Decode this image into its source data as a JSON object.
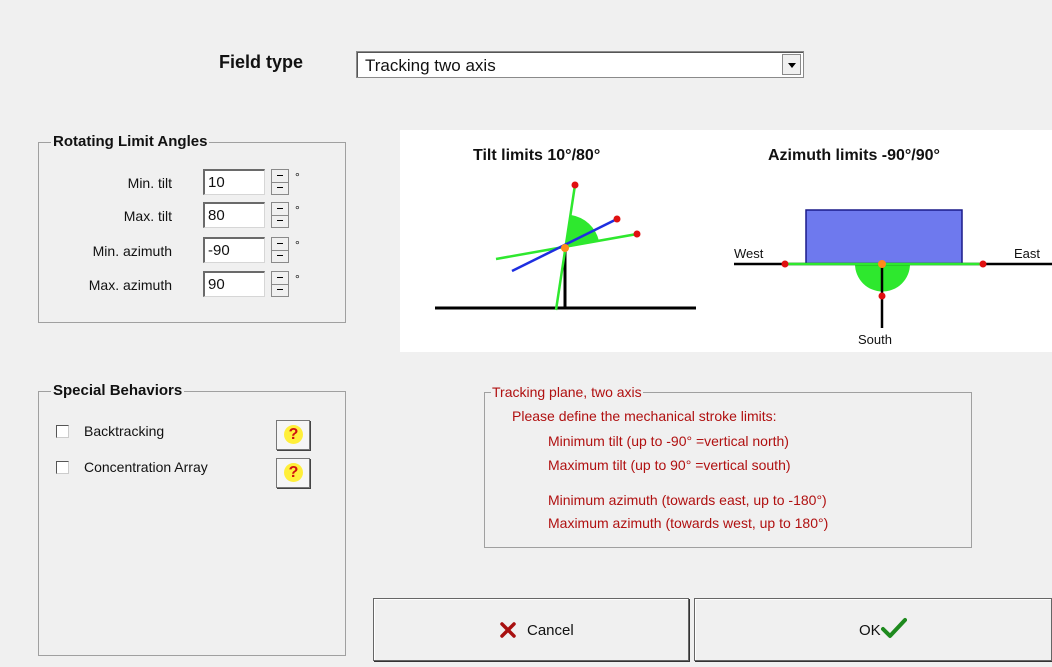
{
  "field_type": {
    "label": "Field type",
    "selected": "Tracking two axis"
  },
  "rotating_limits": {
    "title": "Rotating Limit Angles",
    "rows": [
      {
        "label": "Min. tilt",
        "value": "10",
        "unit": "°"
      },
      {
        "label": "Max. tilt",
        "value": "80",
        "unit": "°"
      },
      {
        "label": "Min. azimuth",
        "value": "-90",
        "unit": "°"
      },
      {
        "label": "Max. azimuth",
        "value": "90",
        "unit": "°"
      }
    ]
  },
  "special": {
    "title": "Special Behaviors",
    "options": [
      {
        "label": "Backtracking",
        "checked": false,
        "help": "?"
      },
      {
        "label": "Concentration Array",
        "checked": false,
        "help": "?"
      }
    ]
  },
  "diagram": {
    "tilt_title": "Tilt limits 10°/80°",
    "azimuth_title": "Azimuth limits -90°/90°",
    "west": "West",
    "east": "East",
    "south": "South"
  },
  "info": {
    "title": "Tracking plane, two axis",
    "lines": [
      "Please define the mechanical stroke limits:",
      "Minimum tilt  (up to -90° =vertical north)",
      "Maximum tilt  (up to 90° =vertical south)",
      "Minimum azimuth (towards east, up to -180°)",
      "Maximum azimuth (towards west, up to 180°)"
    ]
  },
  "buttons": {
    "cancel": "Cancel",
    "ok": "OK"
  },
  "colors": {
    "info_text": "#b01010",
    "help_yellow": "#ffef3a",
    "cancel_x": "#a81010",
    "ok_check": "#1e8a1e",
    "panel_blue": "#6e79ee",
    "tilt_green": "#2ee82e",
    "axis_blue": "#1e2ee0",
    "pivot_orange": "#ff8a1a",
    "limit_red": "#e01010"
  }
}
